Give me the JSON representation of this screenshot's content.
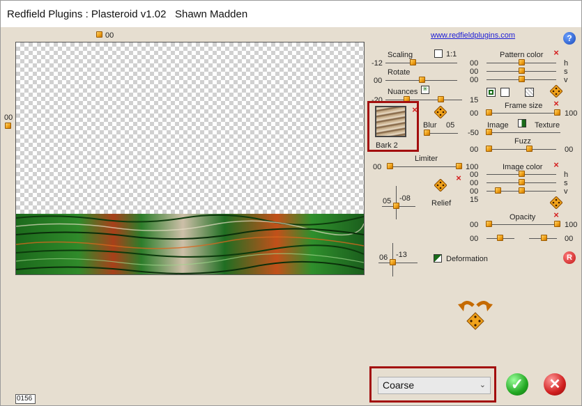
{
  "window": {
    "title": "Redfield Plugins : Plasteroid v1.02   Shawn Madden"
  },
  "header": {
    "link": "www.redfieldplugins.com",
    "help_icon": "help-icon"
  },
  "preview": {
    "top_value": "00",
    "left_value": "00",
    "counter": "0156"
  },
  "controls": {
    "scaling": {
      "label": "Scaling",
      "value": "-12",
      "check_label": "1:1"
    },
    "rotate": {
      "label": "Rotate",
      "value": "00"
    },
    "nuances": {
      "label": "Nuances",
      "value_left": "-20",
      "value_right": "15"
    },
    "texture_thumb": {
      "label": "Bark 2"
    },
    "blur": {
      "label": "Blur",
      "value": "05"
    },
    "limiter": {
      "label": "Limiter",
      "value_left": "00",
      "value_right": "100"
    },
    "relief": {
      "label": "Relief",
      "x": "05",
      "y": "-08"
    },
    "deformation": {
      "label": "Deformation",
      "x": "06",
      "y": "-13"
    },
    "pattern_color": {
      "label": "Pattern color",
      "h": "00",
      "s": "00",
      "v": "00",
      "h_label": "h",
      "s_label": "s",
      "v_label": "v"
    },
    "frame_size": {
      "label": "Frame size",
      "value_left": "00",
      "value_right": "100"
    },
    "image_texture": {
      "left_label": "Image",
      "right_label": "Texture",
      "value": "-50"
    },
    "fuzz": {
      "label": "Fuzz",
      "value_left": "00",
      "value_right": "00"
    },
    "image_color": {
      "label": "Image color",
      "h": "00",
      "s": "00",
      "v": "00",
      "extra": "15",
      "h_label": "h",
      "s_label": "s",
      "v_label": "v"
    },
    "opacity": {
      "label": "Opacity",
      "value_left": "00",
      "value_right": "100",
      "value_left2": "00",
      "value_right2": "00"
    }
  },
  "footer": {
    "select_value": "Coarse",
    "ok_icon": "checkmark-icon",
    "cancel_icon": "cancel-icon"
  },
  "colors": {
    "accent_red": "#a30e0e",
    "knob": "#f0a21a",
    "panel": "#e6ded0"
  }
}
